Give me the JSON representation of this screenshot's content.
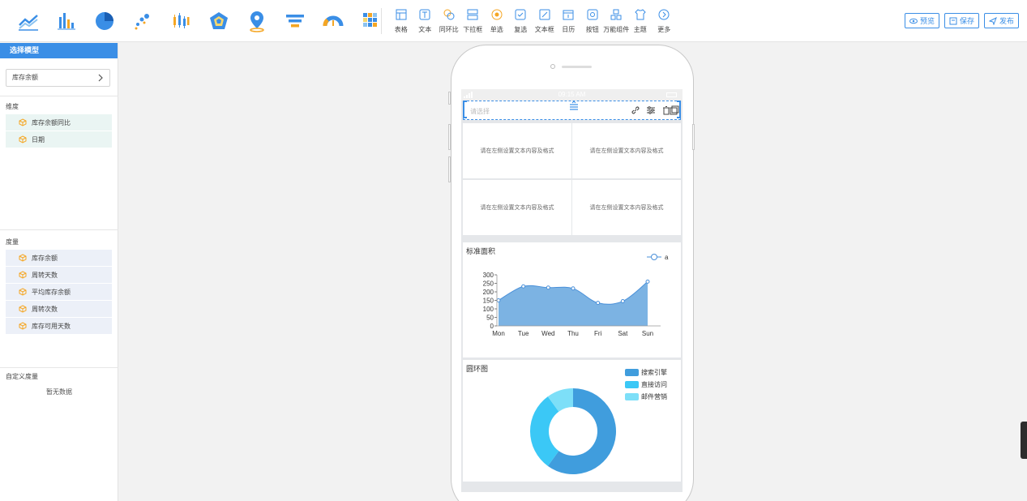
{
  "toolbar": {
    "chart_icons": [
      "line-chart-icon",
      "bar-chart-icon",
      "pie-chart-icon",
      "scatter-chart-icon",
      "candlestick-chart-icon",
      "radar-chart-icon",
      "map-pin-icon",
      "funnel-chart-icon",
      "gauge-chart-icon",
      "heatmap-chart-icon"
    ],
    "components": [
      {
        "label": "表格",
        "icon": "table-icon"
      },
      {
        "label": "文本",
        "icon": "text-icon"
      },
      {
        "label": "同环比",
        "icon": "comparison-icon"
      },
      {
        "label": "下拉框",
        "icon": "dropdown-icon"
      },
      {
        "label": "单选",
        "icon": "radio-icon"
      },
      {
        "label": "复选",
        "icon": "checkbox-icon"
      },
      {
        "label": "文本框",
        "icon": "textbox-icon"
      },
      {
        "label": "日历",
        "icon": "calendar-icon"
      },
      {
        "label": "按钮",
        "icon": "button-icon"
      },
      {
        "label": "万能组件",
        "icon": "universal-component-icon"
      },
      {
        "label": "主题",
        "icon": "theme-icon"
      },
      {
        "label": "更多",
        "icon": "more-icon"
      }
    ],
    "preview_label": "预览",
    "save_label": "保存",
    "publish_label": "发布",
    "accent": "#3a8ee6"
  },
  "left_panel": {
    "header": "选择模型",
    "model": "库存余额",
    "dimension_label": "维度",
    "dimensions": [
      "库存余额同比",
      "日期"
    ],
    "measure_label": "度量",
    "measures": [
      "库存余额",
      "周转天数",
      "平均库存余额",
      "周转次数",
      "库存可用天数"
    ],
    "custom_measure_label": "自定义度量",
    "custom_measure_empty": "暂无数据"
  },
  "phone": {
    "status_time": "09:15 AM",
    "filter_placeholder": "请选择",
    "text_cards": [
      "请在左侧设置文本内容及格式",
      "请在左侧设置文本内容及格式",
      "请在左侧设置文本内容及格式",
      "请在左侧设置文本内容及格式"
    ]
  },
  "chart_data": [
    {
      "type": "area",
      "title": "标准面积",
      "categories": [
        "Mon",
        "Tue",
        "Wed",
        "Thu",
        "Fri",
        "Sat",
        "Sun"
      ],
      "series": [
        {
          "name": "a",
          "values": [
            150,
            232,
            225,
            220,
            135,
            145,
            260
          ],
          "color": "#7cb3e3"
        }
      ],
      "ylim": [
        0,
        300
      ],
      "yticks": [
        0,
        50,
        100,
        150,
        200,
        250,
        300
      ],
      "legend": "top-right"
    },
    {
      "type": "pie",
      "title": "圆环图",
      "donut": true,
      "slices": [
        {
          "name": "搜索引擎",
          "value": 60,
          "color": "#409ddd"
        },
        {
          "name": "直接访问",
          "value": 30,
          "color": "#3bc8f6"
        },
        {
          "name": "邮件营销",
          "value": 10,
          "color": "#7ddff8"
        }
      ],
      "legend": "top-right"
    }
  ]
}
